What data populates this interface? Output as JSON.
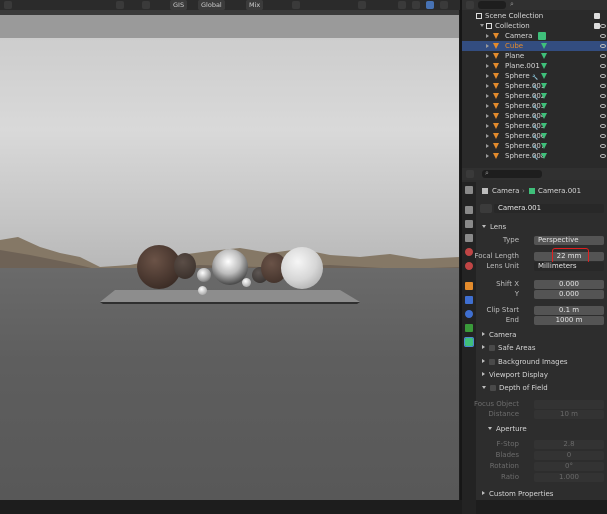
{
  "toolbar": {
    "transform_global": "GIS",
    "orientation": "Global",
    "pivot": "Mix"
  },
  "outliner": {
    "root": "Scene Collection",
    "collection": "Collection",
    "items": [
      {
        "label": "Camera",
        "selected": false
      },
      {
        "label": "Cube",
        "selected": true
      },
      {
        "label": "Plane",
        "selected": false
      },
      {
        "label": "Plane.001",
        "selected": false
      },
      {
        "label": "Sphere",
        "selected": false
      },
      {
        "label": "Sphere.001",
        "selected": false
      },
      {
        "label": "Sphere.002",
        "selected": false
      },
      {
        "label": "Sphere.003",
        "selected": false
      },
      {
        "label": "Sphere.004",
        "selected": false
      },
      {
        "label": "Sphere.005",
        "selected": false
      },
      {
        "label": "Sphere.006",
        "selected": false
      },
      {
        "label": "Sphere.007",
        "selected": false
      },
      {
        "label": "Sphere.008",
        "selected": false
      }
    ]
  },
  "properties": {
    "breadcrumb_object": "Camera",
    "breadcrumb_data": "Camera.001",
    "datablock_name": "Camera.001",
    "lens_section": "Lens",
    "type_label": "Type",
    "type_value": "Perspective",
    "focal_label": "Focal Length",
    "focal_value": "22 mm",
    "lens_unit_label": "Lens Unit",
    "lens_unit_value": "Millimeters",
    "shift_x_label": "Shift X",
    "shift_x_value": "0.000",
    "shift_y_label": "Y",
    "shift_y_value": "0.000",
    "clip_start_label": "Clip Start",
    "clip_start_value": "0.1 m",
    "clip_end_label": "End",
    "clip_end_value": "1000 m",
    "camera_section": "Camera",
    "safe_areas_section": "Safe Areas",
    "bg_images_section": "Background Images",
    "viewport_display_section": "Viewport Display",
    "dof_section": "Depth of Field",
    "focus_object_label": "Focus Object",
    "distance_label": "Distance",
    "distance_value": "10 m",
    "aperture_section": "Aperture",
    "fstop_label": "F-Stop",
    "fstop_value": "2.8",
    "blades_label": "Blades",
    "blades_value": "0",
    "rotation_label": "Rotation",
    "rotation_value": "0°",
    "ratio_label": "Ratio",
    "ratio_value": "1.000",
    "custom_props_section": "Custom Properties"
  },
  "colors": {
    "selection": "#334d80",
    "highlight_box": "#e02020",
    "object_orange": "#e38b2c",
    "material_green": "#3fbf7a"
  }
}
